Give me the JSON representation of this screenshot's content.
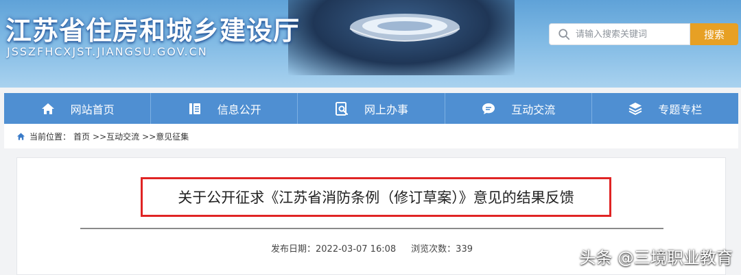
{
  "header": {
    "title": "江苏省住房和城乡建设厅",
    "domain": "JSSZFHCXJST.JIANGSU.GOV.CN"
  },
  "search": {
    "placeholder": "请输入搜索关键词",
    "button_label": "搜索"
  },
  "nav": {
    "items": [
      {
        "label": "网站首页",
        "icon": "home-icon"
      },
      {
        "label": "信息公开",
        "icon": "document-icon"
      },
      {
        "label": "网上办事",
        "icon": "online-service-icon"
      },
      {
        "label": "互动交流",
        "icon": "chat-icon"
      },
      {
        "label": "专题专栏",
        "icon": "layers-icon"
      }
    ]
  },
  "breadcrumb": {
    "prefix": "当前位置：",
    "items": [
      "首页",
      ">>互动交流",
      ">>意见征集"
    ]
  },
  "article": {
    "title": "关于公开征求《江苏省消防条例（修订草案）》意见的结果反馈",
    "publish_date_label": "发布日期：",
    "publish_date": "2022-03-07 16:08",
    "views_label": "浏览次数：",
    "views": "339"
  },
  "watermark": "头条 @三境职业教育",
  "colors": {
    "nav_bg": "#4f8fd2",
    "search_button": "#e7a024",
    "title_highlight_border": "#e02424"
  }
}
